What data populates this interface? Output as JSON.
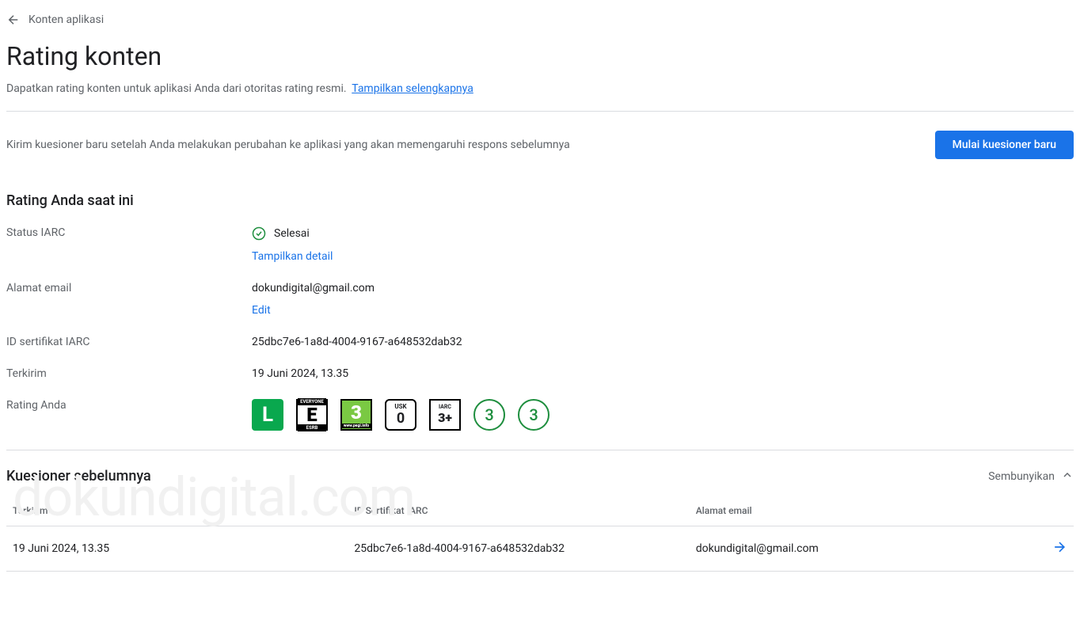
{
  "backLink": "Konten aplikasi",
  "pageTitle": "Rating konten",
  "pageSubtitle": "Dapatkan rating konten untuk aplikasi Anda dari otoritas rating resmi.",
  "learnMore": "Tampilkan selengkapnya",
  "actionBar": {
    "text": "Kirim kuesioner baru setelah Anda melakukan perubahan ke aplikasi yang akan memengaruhi respons sebelumnya",
    "button": "Mulai kuesioner baru"
  },
  "currentSection": {
    "title": "Rating Anda saat ini",
    "rows": {
      "statusLabel": "Status IARC",
      "statusValue": "Selesai",
      "showDetail": "Tampilkan detail",
      "emailLabel": "Alamat email",
      "emailValue": "dokundigital@gmail.com",
      "editLink": "Edit",
      "certLabel": "ID sertifikat IARC",
      "certValue": "25dbc7e6-1a8d-4004-9167-a648532dab32",
      "sentLabel": "Terkirim",
      "sentValue": "19 Juni 2024, 13.35",
      "ratingLabel": "Rating Anda"
    }
  },
  "badges": {
    "l": "L",
    "esrbTop": "EVERYONE",
    "esrbMid": "E",
    "esrbBot": "ESRB",
    "pegi": "3",
    "pegiSub": "www.pegi.info",
    "uskTop": "USK",
    "uskNum": "0",
    "iarcTop": "IARC",
    "iarcNum": "3+",
    "circle1": "3",
    "circle2": "3"
  },
  "watermark": "dokundigital.com",
  "prevSection": {
    "title": "Kuesioner sebelumnya",
    "hide": "Sembunyikan",
    "headers": {
      "sent": "Terkirim",
      "cert": "ID Sertifikat IARC",
      "email": "Alamat email"
    },
    "row": {
      "sent": "19 Juni 2024, 13.35",
      "cert": "25dbc7e6-1a8d-4004-9167-a648532dab32",
      "email": "dokundigital@gmail.com"
    }
  }
}
